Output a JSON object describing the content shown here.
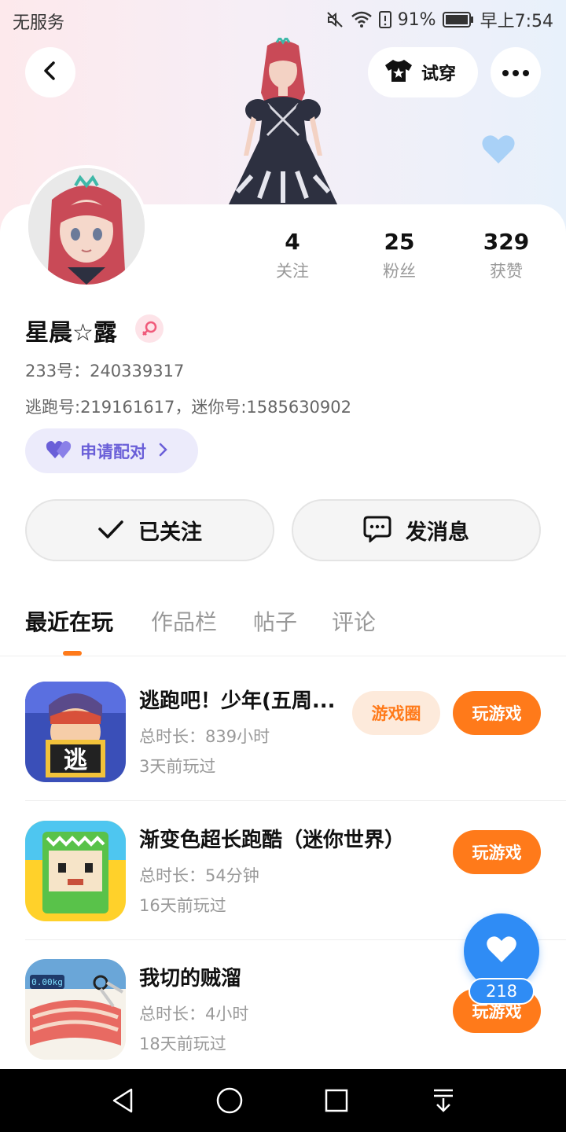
{
  "status_bar": {
    "carrier": "无服务",
    "battery": "91%",
    "time": "早上7:54"
  },
  "header": {
    "try_on_label": "试穿"
  },
  "profile": {
    "nickname": "星晨☆露",
    "id_233": "233号：240339317",
    "other_ids": "逃跑号:219161617，迷你号:1585630902",
    "pair_label": "申请配对",
    "stats": [
      {
        "value": "4",
        "label": "关注"
      },
      {
        "value": "25",
        "label": "粉丝"
      },
      {
        "value": "329",
        "label": "获赞"
      }
    ]
  },
  "actions": {
    "followed_label": "已关注",
    "message_label": "发消息"
  },
  "tabs": [
    {
      "label": "最近在玩",
      "active": true
    },
    {
      "label": "作品栏",
      "active": false
    },
    {
      "label": "帖子",
      "active": false
    },
    {
      "label": "评论",
      "active": false
    }
  ],
  "games": [
    {
      "title": "逃跑吧！少年(五周...",
      "duration": "总时长：839小时",
      "last_played": "3天前玩过",
      "circle_label": "游戏圈",
      "play_label": "玩游戏"
    },
    {
      "title": "渐变色超长跑酷（迷你世界）",
      "duration": "总时长：54分钟",
      "last_played": "16天前玩过",
      "play_label": "玩游戏"
    },
    {
      "title": "我切的贼溜",
      "duration": "总时长：4小时",
      "last_played": "18天前玩过",
      "play_label": "玩游戏",
      "icon_label": "0.00kg"
    }
  ],
  "like_fab": {
    "count": "218"
  },
  "colors": {
    "accent_orange": "#ff7a1a",
    "fab_blue": "#2f8cf5",
    "pair_purple": "#6a5fd8"
  }
}
